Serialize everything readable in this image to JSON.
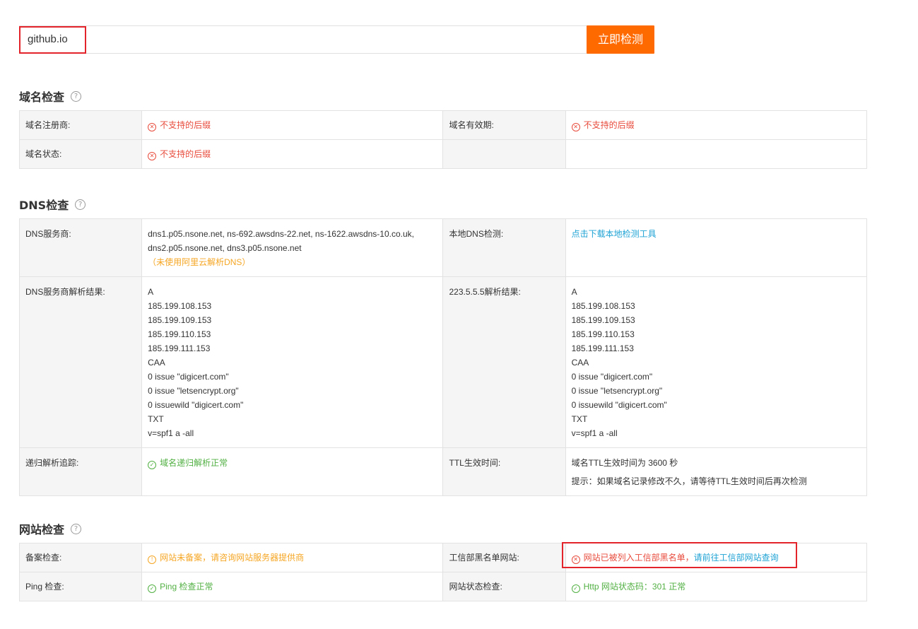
{
  "search": {
    "value": "github.io",
    "button_label": "立即检测"
  },
  "domain_section": {
    "title": "域名检查",
    "help": "?",
    "rows": [
      {
        "label1": "域名注册商:",
        "value1": "不支持的后缀",
        "label2": "域名有效期:",
        "value2": "不支持的后缀"
      },
      {
        "label1": "域名状态:",
        "value1": "不支持的后缀",
        "label2": "",
        "value2": ""
      }
    ]
  },
  "dns_section": {
    "title": "DNS检查",
    "help": "?",
    "provider_label": "DNS服务商:",
    "provider_line1": "dns1.p05.nsone.net, ns-692.awsdns-22.net, ns-1622.awsdns-10.co.uk,",
    "provider_line2": "dns2.p05.nsone.net, dns3.p05.nsone.net",
    "provider_note": "（未使用阿里云解析DNS）",
    "local_label": "本地DNS检测:",
    "local_link": "点击下载本地检测工具",
    "resolve_label": "DNS服务商解析结果:",
    "resolve_lines": [
      "A",
      "185.199.108.153",
      "185.199.109.153",
      "185.199.110.153",
      "185.199.111.153",
      "CAA",
      "0 issue \"digicert.com\"",
      "0 issue \"letsencrypt.org\"",
      "0 issuewild \"digicert.com\"",
      "TXT",
      "v=spf1 a -all"
    ],
    "public_label": "223.5.5.5解析结果:",
    "public_lines": [
      "A",
      "185.199.108.153",
      "185.199.109.153",
      "185.199.110.153",
      "185.199.111.153",
      "CAA",
      "0 issue \"digicert.com\"",
      "0 issue \"letsencrypt.org\"",
      "0 issuewild \"digicert.com\"",
      "TXT",
      "v=spf1 a -all"
    ],
    "trace_label": "递归解析追踪:",
    "trace_value": "域名递归解析正常",
    "ttl_label": "TTL生效时间:",
    "ttl_value": "域名TTL生效时间为 3600 秒",
    "ttl_tip": "提示：如果域名记录修改不久，请等待TTL生效时间后再次检测"
  },
  "site_section": {
    "title": "网站检查",
    "help": "?",
    "icp_label": "备案检查:",
    "icp_value": "网站未备案，请咨询网站服务器提供商",
    "blacklist_label": "工信部黑名单网站:",
    "blacklist_value": "网站已被列入工信部黑名单，",
    "blacklist_link": "请前往工信部网站查询",
    "ping_label": "Ping 检查:",
    "ping_value": "Ping 检查正常",
    "status_label": "网站状态检查:",
    "status_value": "Http 网站状态码：301 正常"
  },
  "icons": {
    "error": "x-circle-icon",
    "ok": "check-circle-icon",
    "warn": "exclamation-circle-icon"
  },
  "colors": {
    "accent": "#ff6a00",
    "error": "#e84c3d",
    "ok": "#52b043",
    "warn": "#f5a623",
    "link": "#1fa3d4",
    "highlight": "#e3242b"
  }
}
